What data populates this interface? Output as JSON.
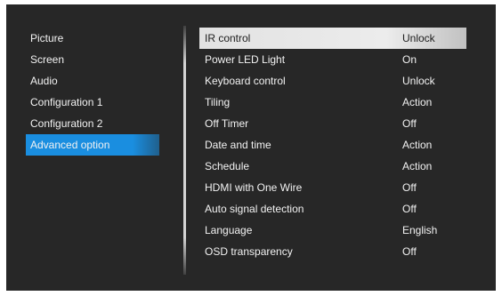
{
  "left_menu": {
    "items": [
      {
        "label": "Picture"
      },
      {
        "label": "Screen"
      },
      {
        "label": "Audio"
      },
      {
        "label": "Configuration 1"
      },
      {
        "label": "Configuration 2"
      },
      {
        "label": "Advanced option",
        "selected": true
      }
    ]
  },
  "settings": {
    "rows": [
      {
        "label": "IR control",
        "value": "Unlock",
        "selected": true
      },
      {
        "label": "Power LED Light",
        "value": "On"
      },
      {
        "label": "Keyboard control",
        "value": "Unlock"
      },
      {
        "label": "Tiling",
        "value": "Action"
      },
      {
        "label": "Off Timer",
        "value": "Off"
      },
      {
        "label": "Date and time",
        "value": "Action"
      },
      {
        "label": "Schedule",
        "value": "Action"
      },
      {
        "label": "HDMI with One Wire",
        "value": "Off"
      },
      {
        "label": "Auto signal detection",
        "value": "Off"
      },
      {
        "label": "Language",
        "value": "English"
      },
      {
        "label": "OSD transparency",
        "value": "Off"
      }
    ]
  },
  "colors": {
    "background": "#272727",
    "accent": "#1a8ee0",
    "highlight": "#ececec",
    "text": "#f2f2f2"
  }
}
